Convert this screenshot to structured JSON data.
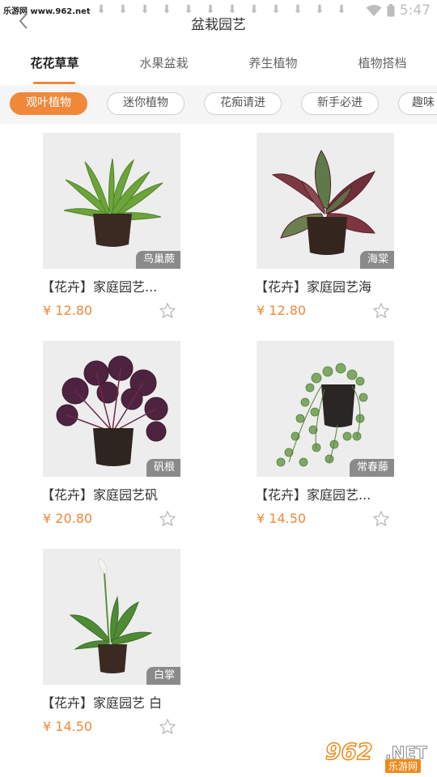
{
  "status_bar": {
    "watermark": "乐游网 www.962.net",
    "time": "5:47",
    "download_glyph": "⬇"
  },
  "header": {
    "title": "盆栽园艺",
    "back_icon": "chevron-left-icon"
  },
  "tabs": [
    {
      "label": "花花草草",
      "active": true
    },
    {
      "label": "水果盆栽",
      "active": false
    },
    {
      "label": "养生植物",
      "active": false
    },
    {
      "label": "植物搭档",
      "active": false
    }
  ],
  "chips": [
    {
      "label": "观叶植物",
      "active": true
    },
    {
      "label": "迷你植物",
      "active": false
    },
    {
      "label": "花痴请进",
      "active": false
    },
    {
      "label": "新手必进",
      "active": false
    },
    {
      "label": "趣味",
      "active": false
    }
  ],
  "products": [
    {
      "title": "【花卉】家庭园艺...",
      "badge": "鸟巢蕨",
      "price": "¥ 12.80"
    },
    {
      "title": "【花卉】家庭园艺海",
      "badge": "海棠",
      "price": "¥ 12.80"
    },
    {
      "title": "【花卉】家庭园艺矾",
      "badge": "矾根",
      "price": "¥ 20.80"
    },
    {
      "title": "【花卉】家庭园艺...",
      "badge": "常春藤",
      "price": "¥ 14.50"
    },
    {
      "title": "【花卉】家庭园艺 白",
      "badge": "白掌",
      "price": "¥ 14.50"
    }
  ],
  "watermark_logo": {
    "num": "962",
    "net": ".NET",
    "cn": "乐游网"
  },
  "colors": {
    "accent": "#f0883a",
    "badge_bg": "#6e6e6e",
    "chip_bar_bg": "#f5f5f5"
  }
}
